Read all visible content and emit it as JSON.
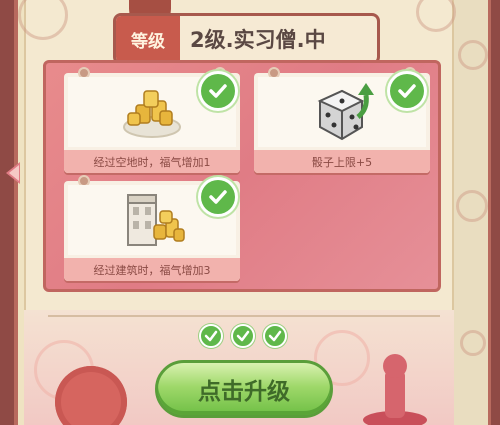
{
  "title": {
    "rank_badge": "等级",
    "level_name": "2级.实习僧.中"
  },
  "rewards": [
    {
      "label": "经过空地时，福气增加1",
      "icon": "gold-coins-icon",
      "completed": true
    },
    {
      "label": "骰子上限+5",
      "icon": "dice-upgrade-icon",
      "completed": true
    },
    {
      "label": "经过建筑时，福气增加3",
      "icon": "building-coins-icon",
      "completed": true
    }
  ],
  "progress": {
    "completed_steps": 3,
    "total_steps": 3
  },
  "upgrade_button": {
    "label": "点击升级"
  },
  "colors": {
    "accent": "#c85b4d",
    "board": "#e07c85",
    "success": "#5fb84a",
    "button": "#9fd86a"
  }
}
